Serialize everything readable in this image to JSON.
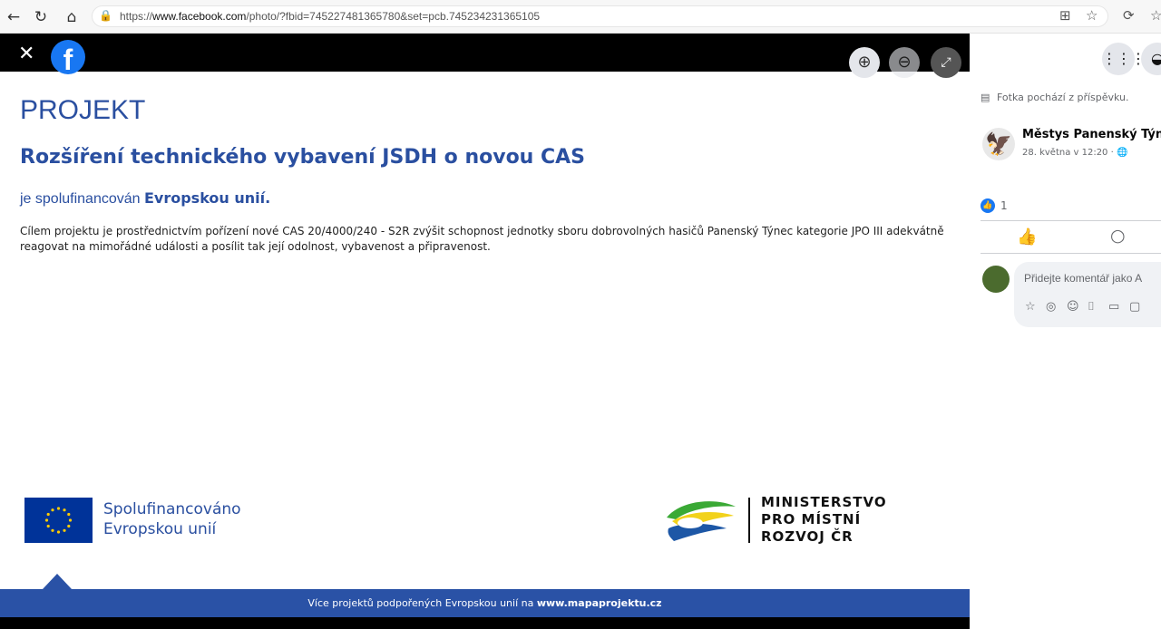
{
  "browser": {
    "url_prefix": "https://",
    "url_domain": "www.facebook.com",
    "url_rest": "/photo/?fbid=745227481365780&set=pcb.745234231365105",
    "icons": [
      "back-icon",
      "reload-icon",
      "home-icon",
      "lock-icon",
      "split-screen-icon",
      "favorite-star-icon",
      "extensions-icon"
    ]
  },
  "viewer": {
    "close_glyph": "✕",
    "logo_glyph": "f",
    "zoom_in_glyph": "⊕",
    "zoom_out_glyph": "⊖",
    "fullscreen_glyph": "⤢"
  },
  "poster": {
    "title": "PROJEKT",
    "project_name": "Rozšíření technického vybavení JSDH o novou CAS",
    "cofinanced_prefix": "je spolufinancován ",
    "cofinanced_bold": "Evropskou unií.",
    "description": "Cílem projektu je prostřednictvím pořízení nové CAS 20/4000/240 - S2R zvýšit schopnost jednotky sboru dobrovolných hasičů Panenský Týnec kategorie JPO III adekvátně reagovat na mimořádné události a posílit tak její odolnost, vybavenost a připravenost.",
    "eu_line1": "Spolufinancováno",
    "eu_line2": "Evropskou unií",
    "mmr_line1": "MINISTERSTVO",
    "mmr_line2": "PRO MÍSTNÍ",
    "mmr_line3": "ROZVOJ ČR",
    "footer_prefix": "Více projektů podpořených Evropskou unií na ",
    "footer_link": "www.mapaprojektu.cz"
  },
  "side": {
    "apps_glyph": "⋮⋮⋮",
    "messenger_glyph": "◒",
    "origin_text": "Fotka pochází z příspěvku.",
    "author_name": "Městys Panenský Týnec",
    "author_date": "28. května v 12:20 · 🌐",
    "like_count": "1",
    "like_glyph": "👍",
    "like_action_glyph": "👍",
    "comment_action_glyph": "○",
    "comment_placeholder": "Přidejte komentář jako A",
    "comment_tools": [
      "☆",
      "◎",
      "☺",
      "⌷",
      "▭",
      "▢"
    ]
  },
  "colors": {
    "brand_blue": "#1877f2",
    "poster_blue": "#2a4fa0",
    "band_blue": "#2a52a6"
  }
}
